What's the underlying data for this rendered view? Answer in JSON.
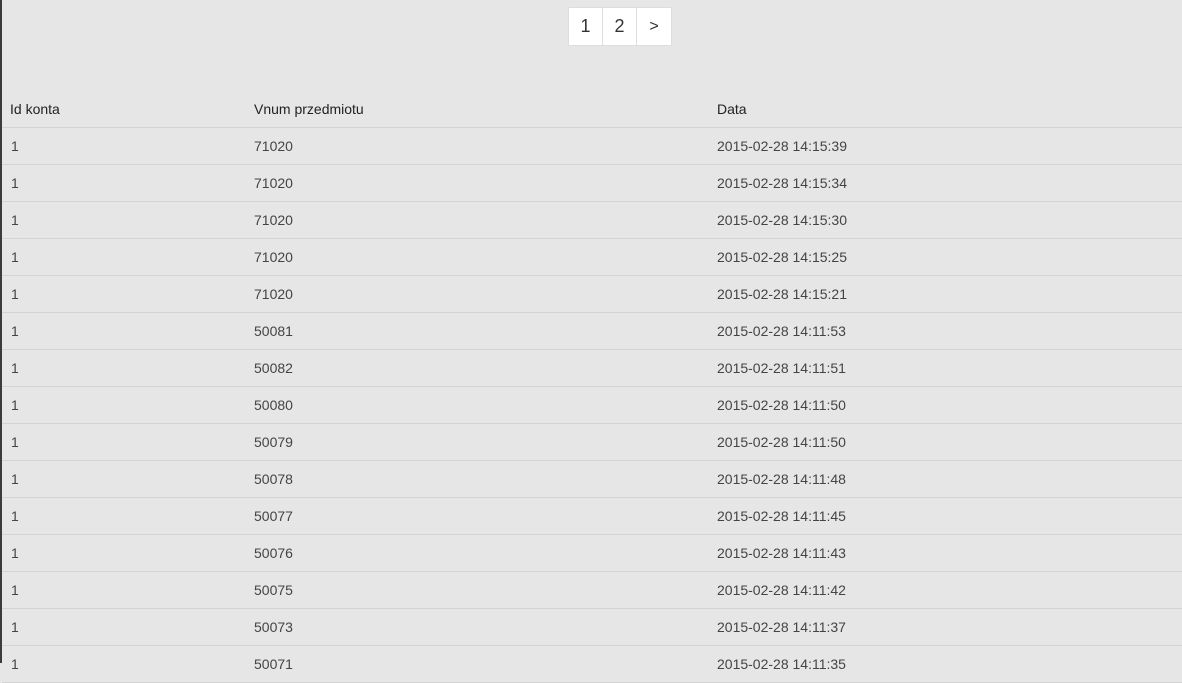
{
  "pagination": {
    "pages": [
      "1",
      "2"
    ],
    "next_label": ">"
  },
  "table": {
    "headers": {
      "id": "Id konta",
      "item": "Vnum przedmiotu",
      "date": "Data"
    },
    "rows": [
      {
        "id": "1",
        "item": "71020",
        "date": "2015-02-28 14:15:39"
      },
      {
        "id": "1",
        "item": "71020",
        "date": "2015-02-28 14:15:34"
      },
      {
        "id": "1",
        "item": "71020",
        "date": "2015-02-28 14:15:30"
      },
      {
        "id": "1",
        "item": "71020",
        "date": "2015-02-28 14:15:25"
      },
      {
        "id": "1",
        "item": "71020",
        "date": "2015-02-28 14:15:21"
      },
      {
        "id": "1",
        "item": "50081",
        "date": "2015-02-28 14:11:53"
      },
      {
        "id": "1",
        "item": "50082",
        "date": "2015-02-28 14:11:51"
      },
      {
        "id": "1",
        "item": "50080",
        "date": "2015-02-28 14:11:50"
      },
      {
        "id": "1",
        "item": "50079",
        "date": "2015-02-28 14:11:50"
      },
      {
        "id": "1",
        "item": "50078",
        "date": "2015-02-28 14:11:48"
      },
      {
        "id": "1",
        "item": "50077",
        "date": "2015-02-28 14:11:45"
      },
      {
        "id": "1",
        "item": "50076",
        "date": "2015-02-28 14:11:43"
      },
      {
        "id": "1",
        "item": "50075",
        "date": "2015-02-28 14:11:42"
      },
      {
        "id": "1",
        "item": "50073",
        "date": "2015-02-28 14:11:37"
      },
      {
        "id": "1",
        "item": "50071",
        "date": "2015-02-28 14:11:35"
      }
    ]
  }
}
